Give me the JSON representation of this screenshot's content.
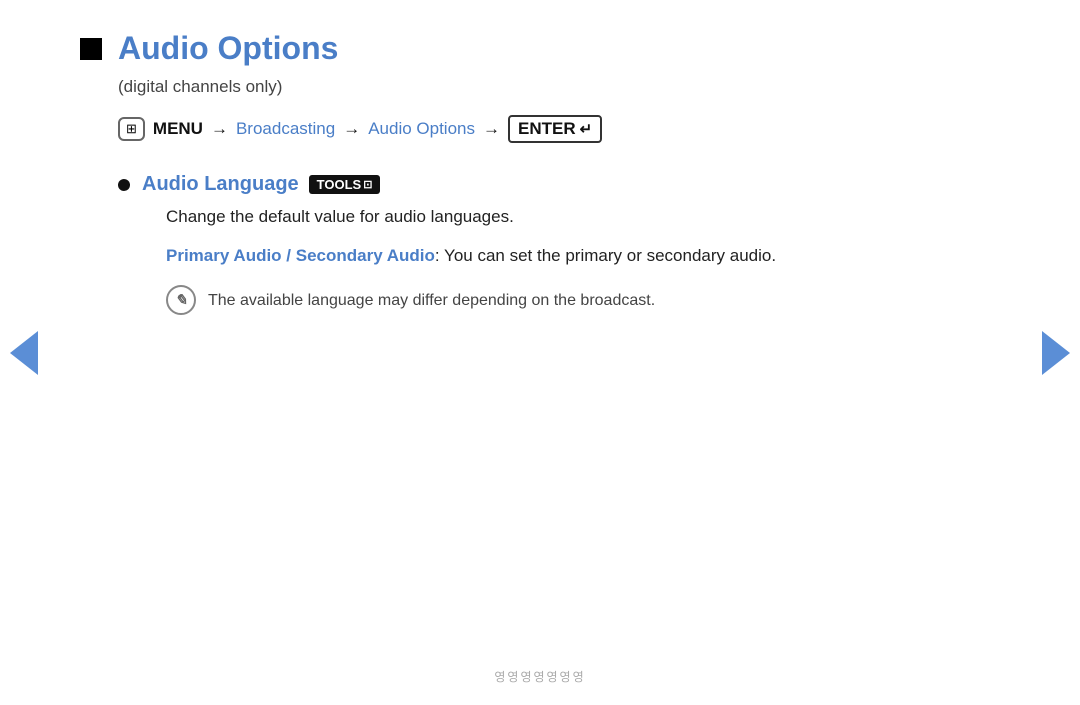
{
  "page": {
    "title": "Audio Options",
    "subtitle": "(digital channels only)",
    "breadcrumb": {
      "menu_label": "MENU",
      "menu_grid": "⊞",
      "arrow1": "→",
      "link1": "Broadcasting",
      "arrow2": "→",
      "link2": "Audio Options",
      "arrow3": "→",
      "enter_label": "ENTER",
      "enter_arrow": "↵"
    },
    "section": {
      "heading": "Audio Language",
      "tools_badge": "TOOLS",
      "tools_icon": "⊡",
      "description": "Change the default value for audio languages.",
      "primary_label": "Primary Audio / Secondary Audio",
      "primary_text": ": You can set the primary or secondary audio.",
      "note_text": "The available language may differ depending on the broadcast."
    },
    "footer": "영영영영영영영",
    "nav": {
      "left_label": "previous",
      "right_label": "next"
    }
  }
}
